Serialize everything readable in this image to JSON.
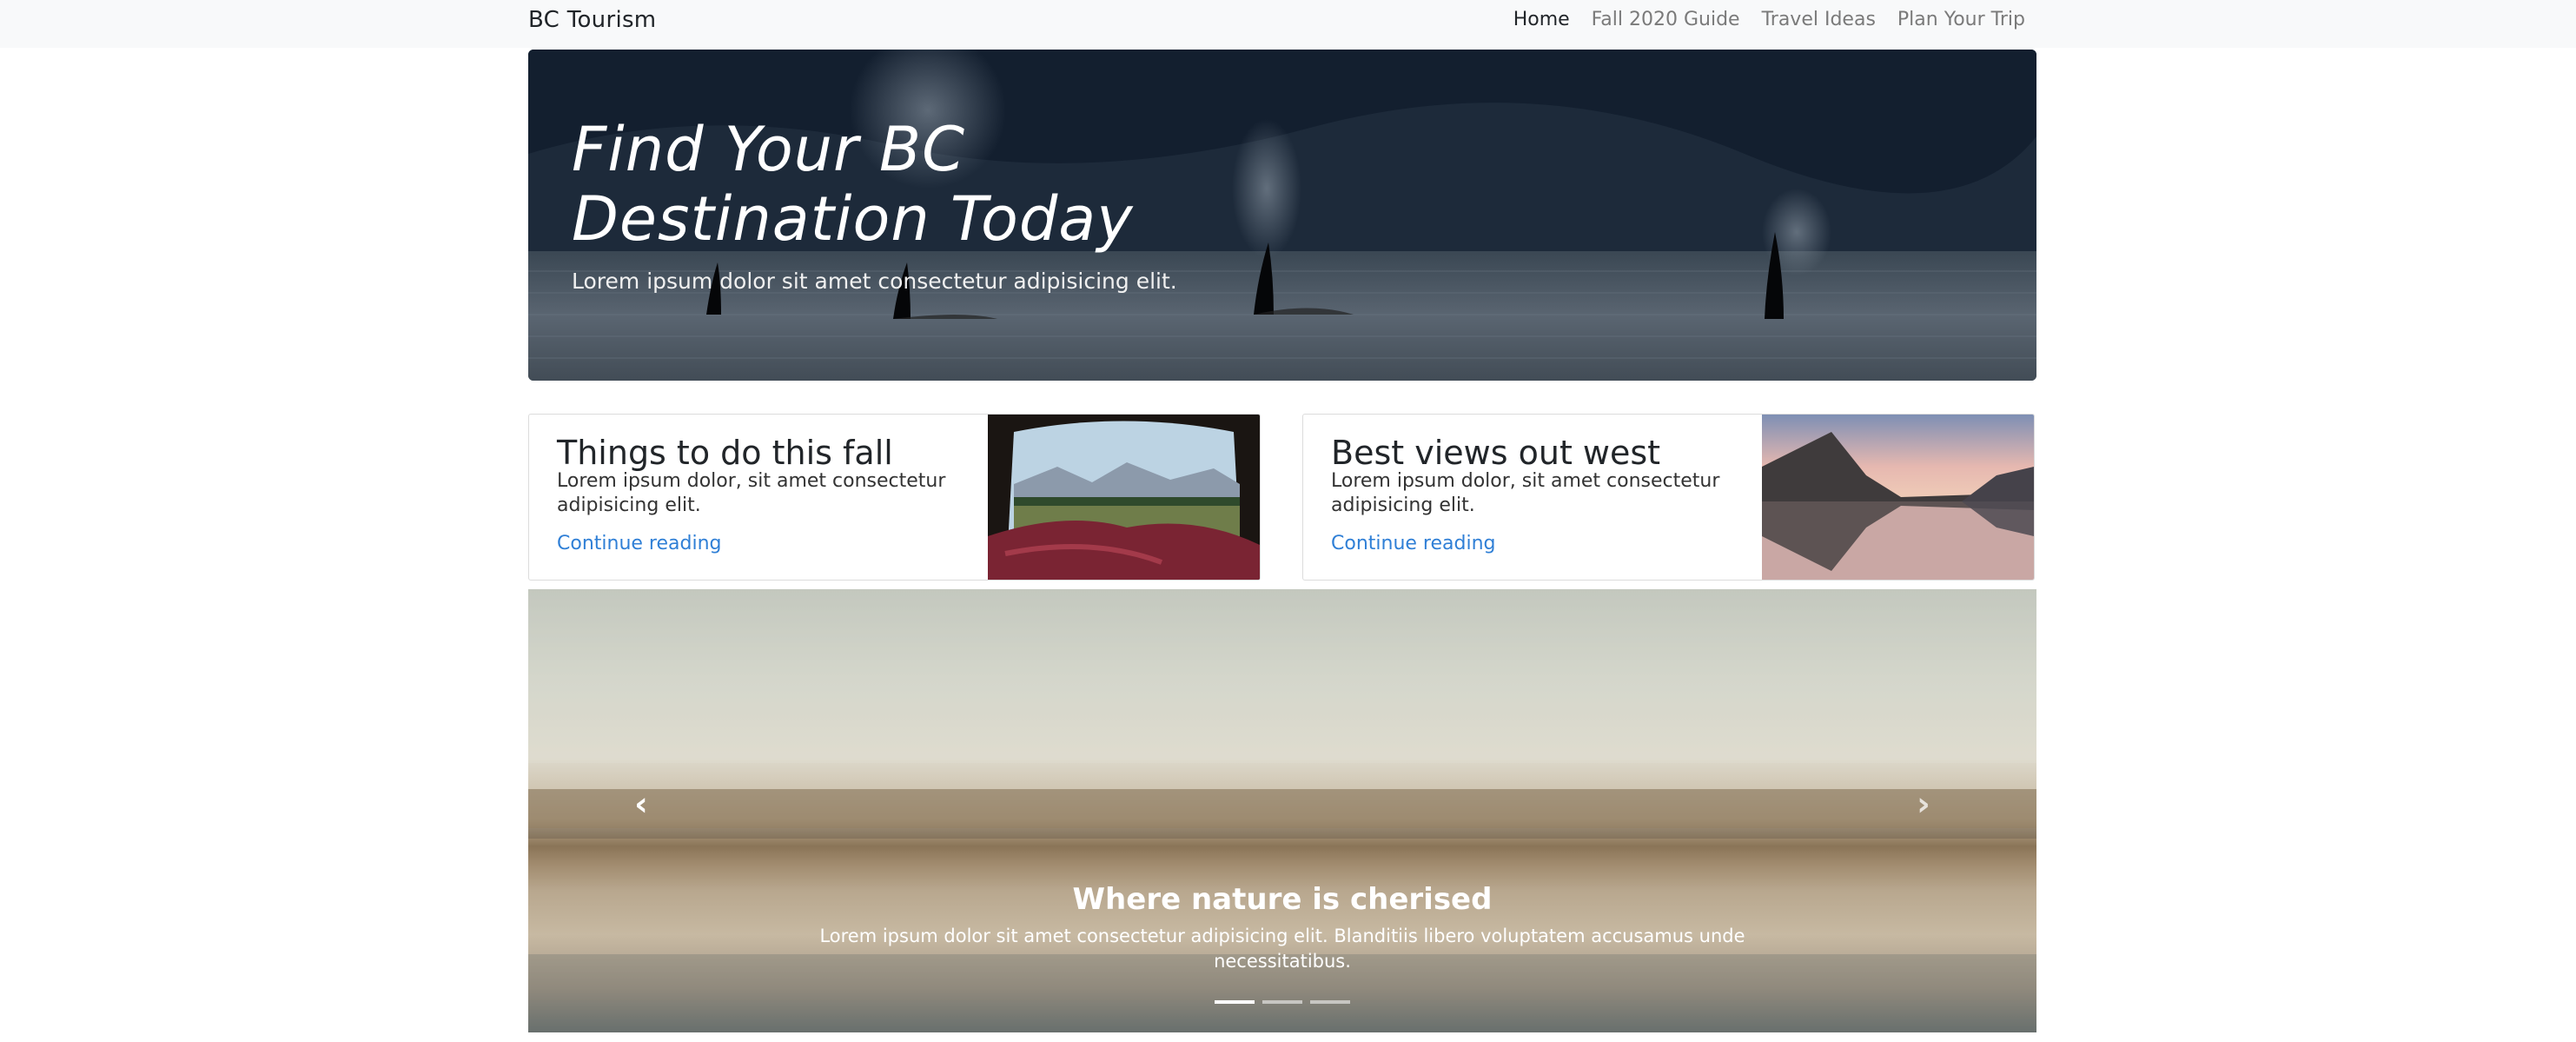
{
  "navbar": {
    "brand": "BC Tourism",
    "links": [
      {
        "label": "Home",
        "active": true
      },
      {
        "label": "Fall 2020 Guide",
        "active": false
      },
      {
        "label": "Travel Ideas",
        "active": false
      },
      {
        "label": "Plan Your Trip",
        "active": false
      }
    ]
  },
  "hero": {
    "title_line1": "Find Your BC",
    "title_line2": "Destination Today",
    "subtitle": "Lorem ipsum dolor sit amet consectetur adipisicing elit."
  },
  "cards": [
    {
      "title": "Things to do this fall",
      "text": "Lorem ipsum dolor, sit amet consectetur adipisicing elit.",
      "link": "Continue reading"
    },
    {
      "title": "Best views out west",
      "text": "Lorem ipsum dolor, sit amet consectetur adipisicing elit.",
      "link": "Continue reading"
    }
  ],
  "carousel": {
    "caption_title": "Where nature is cherised",
    "caption_text": "Lorem ipsum dolor sit amet consectetur adipisicing elit. Blanditiis libero voluptatem accusamus unde necessitatibus.",
    "prev_icon": "chevron-left-icon",
    "next_icon": "chevron-right-icon",
    "active_index": 0,
    "slide_count": 3
  },
  "colors": {
    "link": "#2f7fd6",
    "navbar_bg": "#f8f9fa"
  }
}
